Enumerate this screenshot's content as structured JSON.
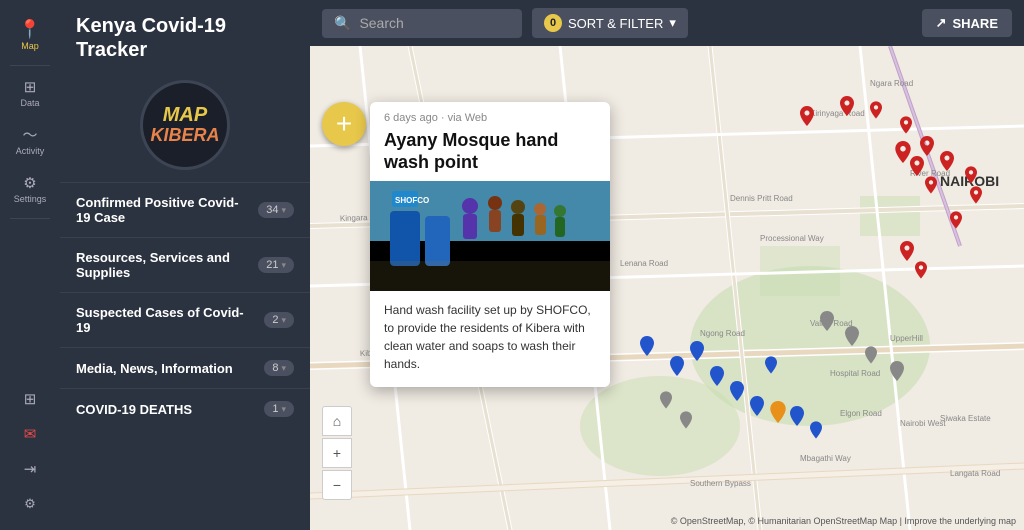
{
  "sidebar": {
    "items": [
      {
        "id": "map",
        "icon": "📍",
        "label": "Map",
        "active": true
      },
      {
        "id": "data",
        "icon": "▦",
        "label": "Data",
        "active": false
      },
      {
        "id": "activity",
        "icon": "〜",
        "label": "Activity",
        "active": false
      },
      {
        "id": "settings",
        "icon": "⚙",
        "label": "Settings",
        "active": false
      },
      {
        "id": "grid",
        "icon": "⊞",
        "label": "",
        "active": false
      },
      {
        "id": "inbox",
        "icon": "✉",
        "label": "",
        "active_red": true
      },
      {
        "id": "logout",
        "icon": "⇥",
        "label": "",
        "active": false
      },
      {
        "id": "cog",
        "icon": "⚙",
        "label": "",
        "active": false
      }
    ]
  },
  "panel": {
    "title": "Kenya Covid-19 Tracker",
    "logo_text": "MAP",
    "logo_sub": "KIBERA",
    "categories": [
      {
        "id": "confirmed",
        "name": "Confirmed Positive Covid-19 Case",
        "count": "34",
        "color": "#cc3333"
      },
      {
        "id": "resources",
        "name": "Resources, Services and Supplies",
        "count": "21",
        "color": "#3399cc"
      },
      {
        "id": "suspected",
        "name": "Suspected Cases of Covid-19",
        "count": "2",
        "color": "#888"
      },
      {
        "id": "media",
        "name": "Media, News, Information",
        "count": "8",
        "color": "#888"
      },
      {
        "id": "deaths",
        "name": "COVID-19 DEATHS",
        "count": "1",
        "color": "#888"
      }
    ]
  },
  "topbar": {
    "search_placeholder": "Search",
    "filter_label": "SORT & FILTER",
    "filter_count": "0",
    "share_label": "SHARE"
  },
  "popup": {
    "meta": "6 days ago  ·  via Web",
    "title": "Ayany Mosque hand wash point",
    "description": "Hand wash facility set up by SHOFCO, to provide the residents of Kibera with clean water and soaps to wash their hands."
  },
  "map": {
    "add_icon": "+",
    "home_icon": "⌂",
    "zoom_in": "+",
    "zoom_out": "−",
    "copyright": "© OpenStreetMap, © Humanitarian OpenStreetMap Map | Improve the underlying map"
  }
}
